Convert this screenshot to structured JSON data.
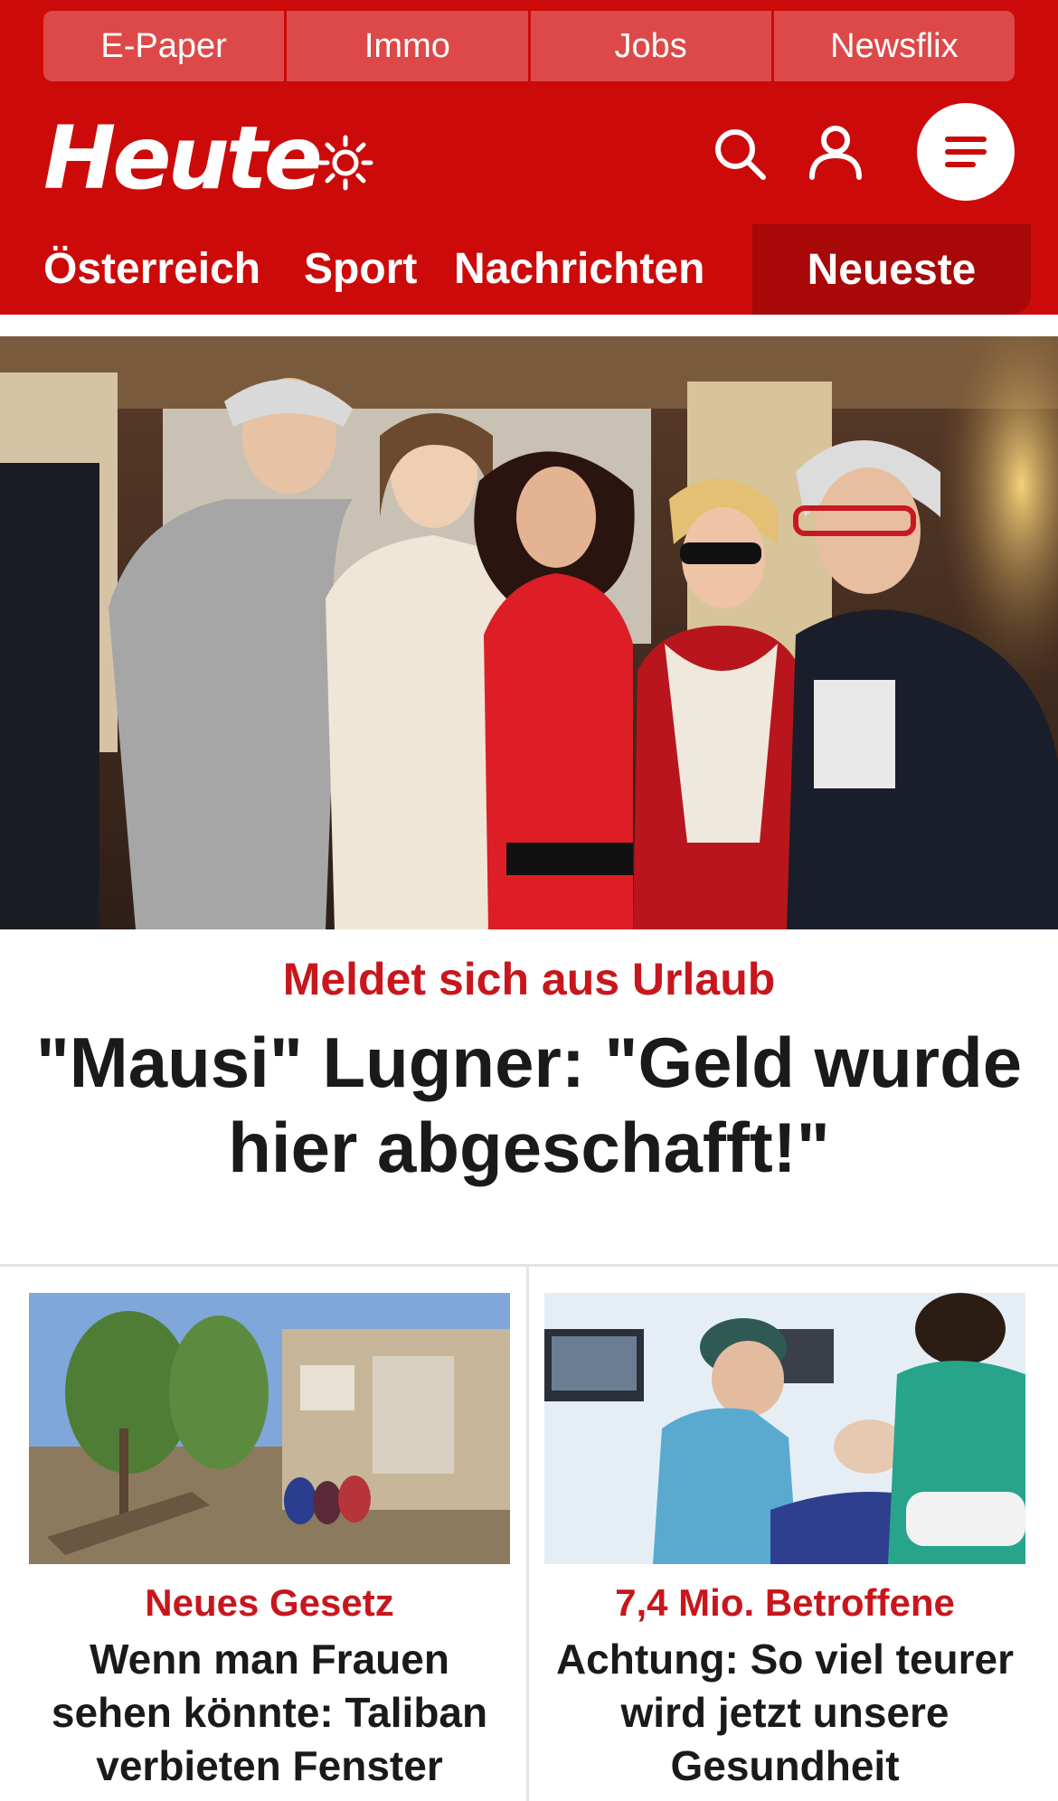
{
  "top_links": [
    "E-Paper",
    "Immo",
    "Jobs",
    "Newsflix"
  ],
  "brand": {
    "logo_text": "Heute"
  },
  "nav": {
    "items": [
      "Österreich",
      "Sport",
      "Nachrichten"
    ],
    "latest": "Neueste"
  },
  "hero": {
    "kicker": "Meldet sich aus Urlaub",
    "title": "\"Mausi\" Lugner: \"Geld wurde hier abgeschafft!\""
  },
  "cards": [
    {
      "kicker": "Neues Gesetz",
      "title": "Wenn man Frauen sehen könnte: Taliban verbieten Fenster"
    },
    {
      "kicker": "7,4 Mio. Betroffene",
      "title": "Achtung: So viel teurer wird jetzt unsere Gesundheit"
    }
  ],
  "colors": {
    "brand_red": "#cc0a0a",
    "kicker_red": "#c8161d",
    "latest_tab": "#a80808"
  },
  "icons": [
    "sun-icon",
    "search-icon",
    "user-icon",
    "menu-icon"
  ]
}
